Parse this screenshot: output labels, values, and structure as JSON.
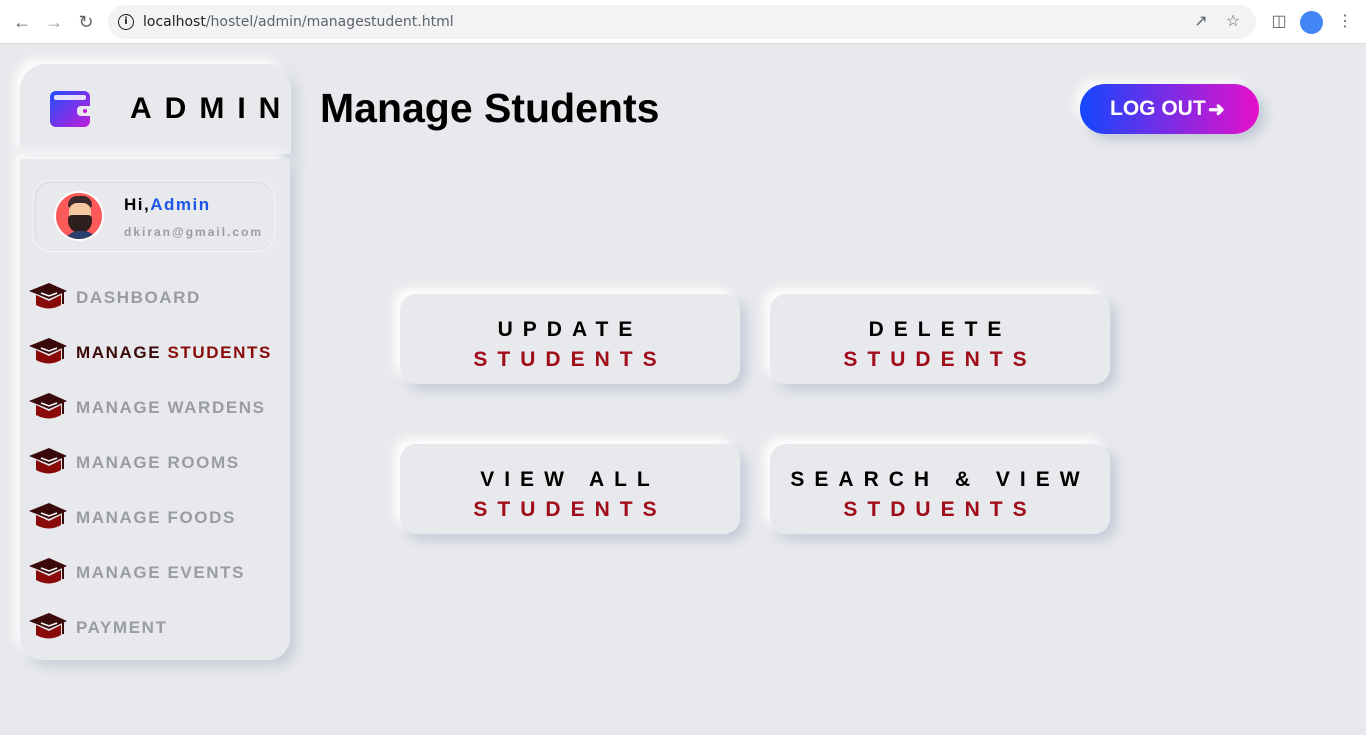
{
  "browser": {
    "url_host": "localhost",
    "url_path": "/hostel/admin/managestudent.html"
  },
  "brand": {
    "title": "ADMIN"
  },
  "profile": {
    "greeting": "Hi,",
    "name": "Admin",
    "email": "dkiran@gmail.com"
  },
  "sidebar": {
    "items": [
      {
        "label": "DASHBOARD"
      },
      {
        "label_pre": "MANAGE ",
        "label_hl": "STUDENTS"
      },
      {
        "label": "MANAGE WARDENS"
      },
      {
        "label": "MANAGE ROOMS"
      },
      {
        "label": "MANAGE FOODS"
      },
      {
        "label": "MANAGE EVENTS"
      },
      {
        "label": "PAYMENT"
      }
    ]
  },
  "header": {
    "title": "Manage Students",
    "logout_label": "LOG OUT"
  },
  "actions": [
    {
      "line1": "UPDATE",
      "line2": "STUDENTS"
    },
    {
      "line1": "DELETE",
      "line2": "STUDENTS"
    },
    {
      "line1": "VIEW ALL",
      "line2": "STUDENTS"
    },
    {
      "line1": "SEARCH & VIEW",
      "line2": "STDUENTS"
    }
  ],
  "colors": {
    "accent_start": "#1447ff",
    "accent_end": "#e510c9",
    "maroon": "#a00c1a",
    "link_blue": "#1a56e8",
    "background": "#e8e9ec"
  }
}
